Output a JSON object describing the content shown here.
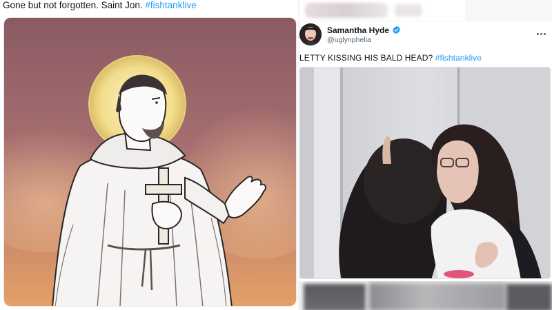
{
  "left_tweet": {
    "text": "Gone but not forgotten. Saint Jon.",
    "hashtag": "#fishtanklive",
    "media": {
      "icon": "saint-illustration",
      "colors": {
        "bg_top": "#8a5a63",
        "bg_mid": "#b98072",
        "bg_bottom": "#e6a066",
        "halo": "#f6e7a4"
      }
    }
  },
  "right_tweet": {
    "author": {
      "display_name": "Samantha Hyde",
      "handle": "@uglynphelia",
      "verified": true
    },
    "text": "LETTY KISSING HIS BALD HEAD?",
    "hashtag": "#fishtanklive",
    "media": {
      "icon": "video-still"
    },
    "colors": {
      "accent": "#1d9bf0",
      "muted": "#536471"
    }
  }
}
